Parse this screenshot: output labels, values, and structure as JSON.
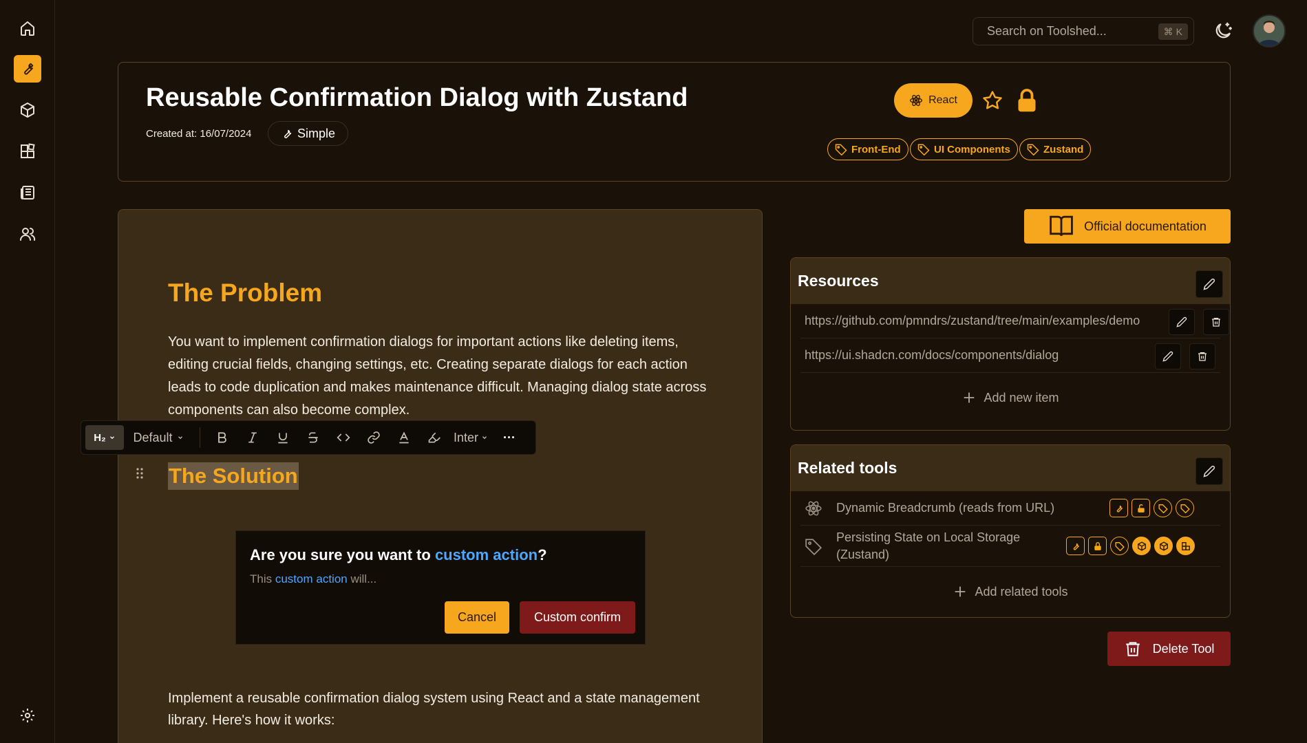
{
  "search": {
    "placeholder": "Search on Toolshed...",
    "shortcut_symbol": "⌘",
    "shortcut_key": "K"
  },
  "header": {
    "title": "Reusable Confirmation Dialog with Zustand",
    "created_at": "Created at: 16/07/2024",
    "complexity": "Simple",
    "framework": "React",
    "tags": [
      "Front-End",
      "UI Components",
      "Zustand"
    ]
  },
  "editor": {
    "problem_heading": "The Problem",
    "problem_text": "You want to implement confirmation dialogs for important actions like deleting items, editing crucial fields, changing settings, etc. Creating separate dialogs for each action leads to code duplication and makes maintenance difficult. Managing dialog state across components can also become complex.",
    "solution_heading": "The Solution",
    "solution_text": "Implement a reusable confirmation dialog system using React and a state management library. Here's how it works:",
    "dialog": {
      "question_prefix": "Are you sure you want to ",
      "question_highlight": "custom action",
      "question_suffix": "?",
      "desc_prefix": "This ",
      "desc_highlight": "custom action",
      "desc_suffix": " will...",
      "cancel_label": "Cancel",
      "confirm_label": "Custom confirm"
    },
    "toolbar": {
      "heading_label": "H₂",
      "style_label": "Default",
      "font_label": "Inter",
      "more_label": "···"
    }
  },
  "docs_button": "Official documentation",
  "resources": {
    "title": "Resources",
    "items": [
      "https://github.com/pmndrs/zustand/tree/main/examples/demo",
      "https://ui.shadcn.com/docs/components/dialog"
    ],
    "add_label": "Add new item"
  },
  "related": {
    "title": "Related tools",
    "items": [
      {
        "name": "Dynamic Breadcrumb (reads from URL)"
      },
      {
        "name_line1": "Persisting State on Local Storage",
        "name_line2": "(Zustand)"
      }
    ],
    "add_label": "Add related tools"
  },
  "delete_label": "Delete Tool",
  "colors": {
    "accent": "#f7a71d",
    "danger": "#7e1b1a",
    "background": "#1a1209",
    "card": "#3b2c17"
  }
}
